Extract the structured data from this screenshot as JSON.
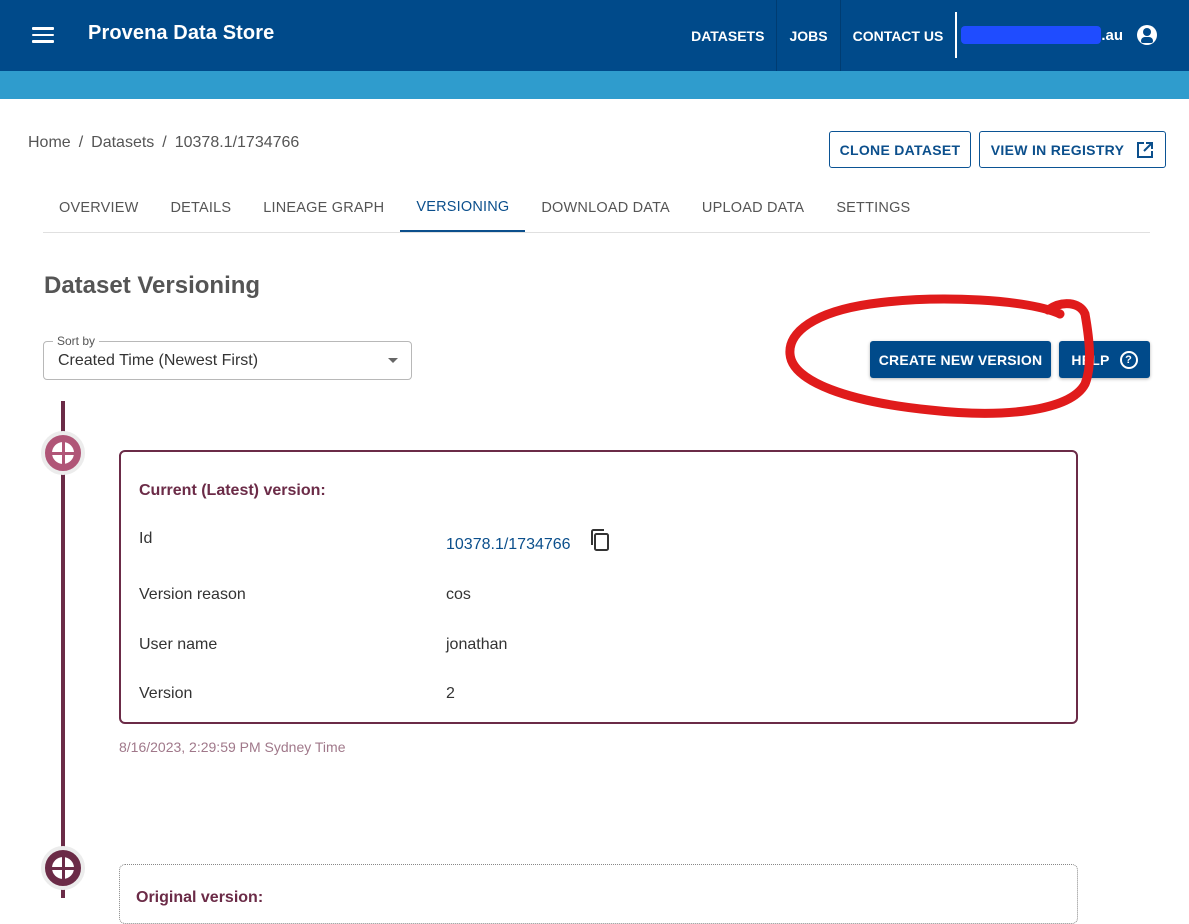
{
  "app": {
    "title": "Provena Data Store",
    "nav": [
      "DATASETS",
      "JOBS",
      "CONTACT US"
    ],
    "user_suffix": ".au"
  },
  "breadcrumb": [
    "Home",
    "Datasets",
    "10378.1/1734766"
  ],
  "header_buttons": {
    "clone": "CLONE DATASET",
    "registry": "VIEW IN REGISTRY"
  },
  "tabs": [
    "OVERVIEW",
    "DETAILS",
    "LINEAGE GRAPH",
    "VERSIONING",
    "DOWNLOAD DATA",
    "UPLOAD DATA",
    "SETTINGS"
  ],
  "active_tab": "VERSIONING",
  "section_title": "Dataset Versioning",
  "sort": {
    "label": "Sort by",
    "value": "Created Time (Newest First)"
  },
  "actions": {
    "create": "CREATE NEW VERSION",
    "help": "HELP"
  },
  "current_version": {
    "heading": "Current (Latest) version:",
    "rows": [
      {
        "label": "Id",
        "value": "10378.1/1734766"
      },
      {
        "label": "Version reason",
        "value": "cos"
      },
      {
        "label": "User name",
        "value": "jonathan"
      },
      {
        "label": "Version",
        "value": "2"
      }
    ],
    "timestamp": "8/16/2023, 2:29:59 PM Sydney Time"
  },
  "original_version": {
    "heading": "Original version:"
  },
  "colors": {
    "appbar": "#004a8a",
    "subbar": "#2f9ccd",
    "timeline": "#6b2b47",
    "annotation": "#e01b1b"
  }
}
